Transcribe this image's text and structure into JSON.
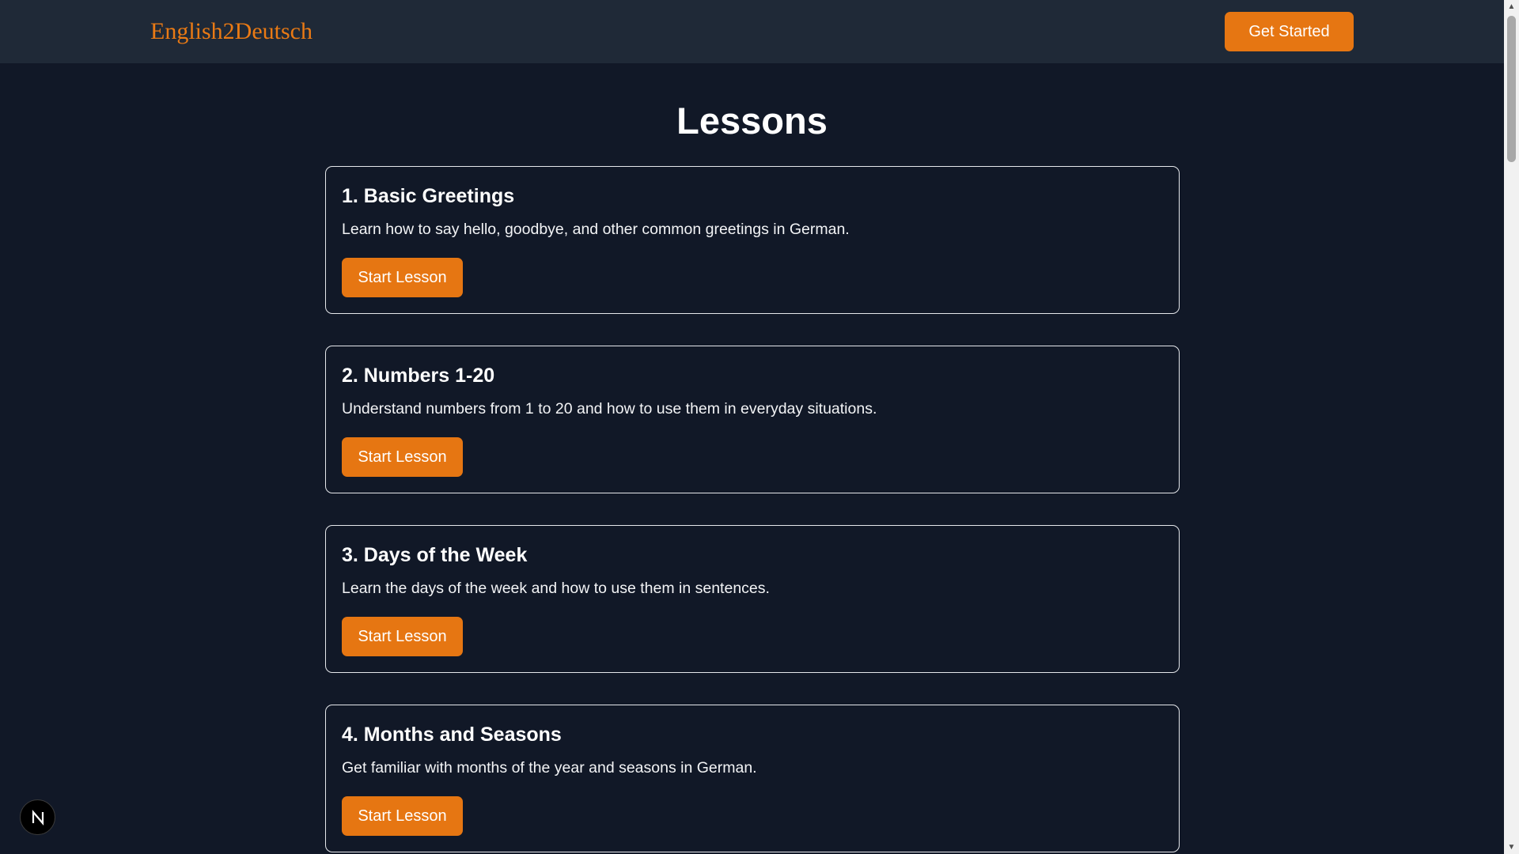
{
  "header": {
    "brand": "English2Deutsch",
    "cta_label": "Get Started"
  },
  "main": {
    "title": "Lessons",
    "lessons": [
      {
        "title": "1. Basic Greetings",
        "description": "Learn how to say hello, goodbye, and other common greetings in German.",
        "button_label": "Start Lesson"
      },
      {
        "title": "2. Numbers 1-20",
        "description": "Understand numbers from 1 to 20 and how to use them in everyday situations.",
        "button_label": "Start Lesson"
      },
      {
        "title": "3. Days of the Week",
        "description": "Learn the days of the week and how to use them in sentences.",
        "button_label": "Start Lesson"
      },
      {
        "title": "4. Months and Seasons",
        "description": "Get familiar with months of the year and seasons in German.",
        "button_label": "Start Lesson"
      }
    ]
  },
  "colors": {
    "background": "#111827",
    "header_bg": "#1f2937",
    "accent": "#e67612",
    "card_border": "#e5e7eb"
  },
  "icons": {
    "dev_badge": "next-logo-icon"
  }
}
